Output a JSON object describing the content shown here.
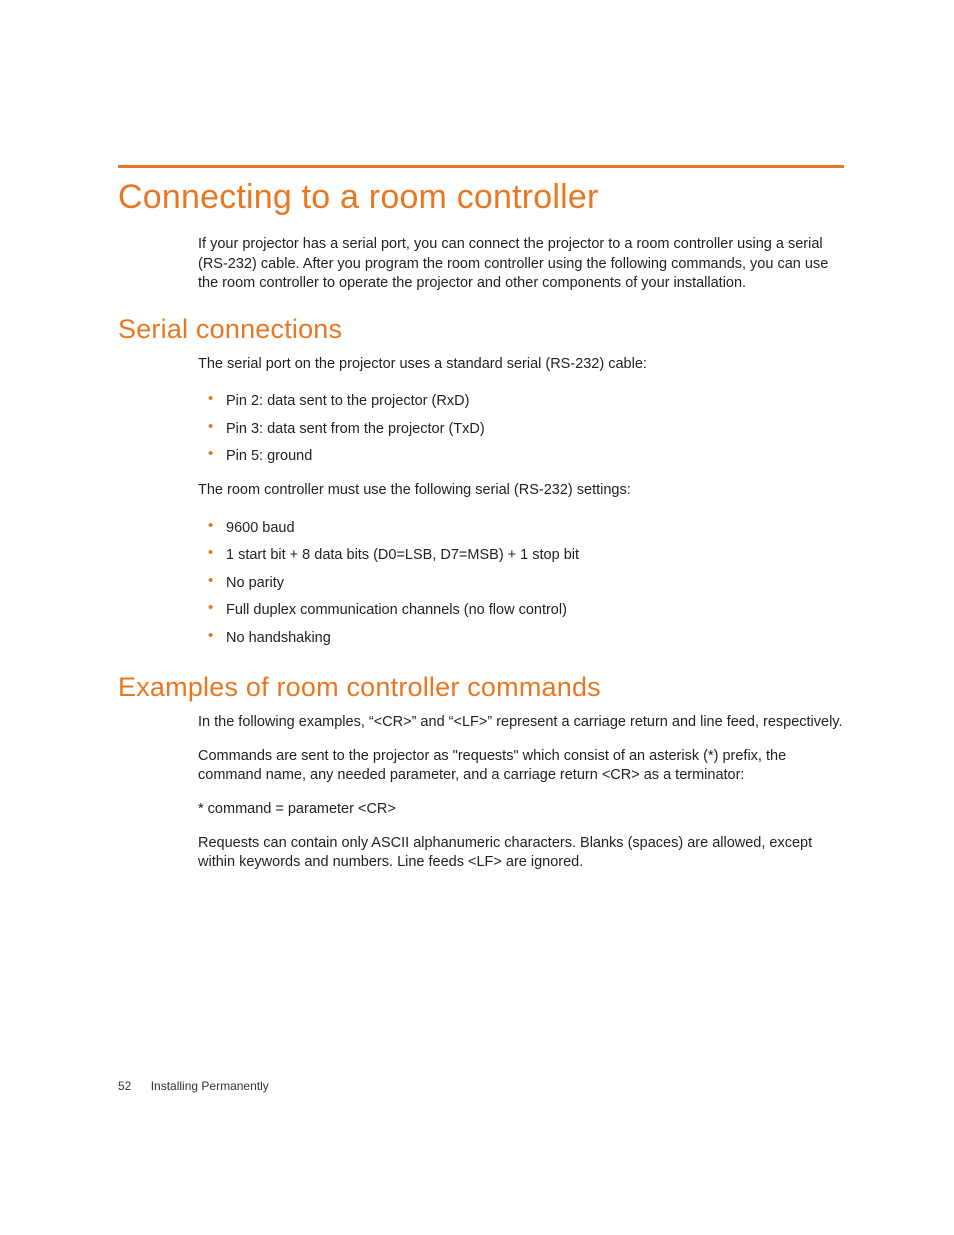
{
  "heading": "Connecting to a room controller",
  "intro": "If your projector has a serial port, you can connect the projector to a room controller using a serial (RS-232) cable. After you program the room controller using the following commands, you can use the room controller to operate the projector and other components of your installation.",
  "serial": {
    "title": "Serial connections",
    "lead": "The serial port on the projector uses a standard serial (RS-232) cable:",
    "pins": [
      "Pin 2: data sent to the projector (RxD)",
      "Pin 3: data sent from the projector (TxD)",
      "Pin 5: ground"
    ],
    "settings_lead": "The room controller must use the following serial (RS-232) settings:",
    "settings": [
      "9600 baud",
      "1 start bit + 8 data bits (D0=LSB, D7=MSB) + 1 stop bit",
      "No parity",
      "Full duplex communication channels (no flow control)",
      "No handshaking"
    ]
  },
  "examples": {
    "title": "Examples of room controller commands",
    "p1": "In the following examples, “<CR>” and “<LF>” represent a carriage return and line feed, respectively.",
    "p2": "Commands are sent to the projector as \"requests\" which consist of an asterisk (*) prefix, the command name, any needed parameter, and a carriage return <CR> as a terminator:",
    "cmd": "* command = parameter <CR>",
    "p3": "Requests can contain only ASCII alphanumeric characters. Blanks (spaces) are allowed, except within keywords and numbers. Line feeds <LF> are ignored."
  },
  "footer": {
    "page": "52",
    "section": "Installing Permanently"
  }
}
